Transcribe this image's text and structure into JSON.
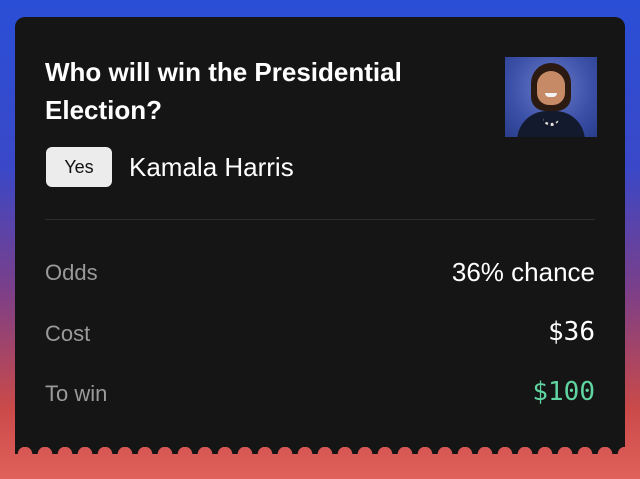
{
  "question": {
    "title": "Who will win the Presidential Election?"
  },
  "selection": {
    "badge": "Yes",
    "candidate": "Kamala Harris"
  },
  "details": {
    "odds_label": "Odds",
    "odds_value": "36% chance",
    "cost_label": "Cost",
    "cost_value": "$36",
    "win_label": "To win",
    "win_value": "$100"
  },
  "colors": {
    "win_accent": "#5fd3a0",
    "card_bg": "#151515"
  }
}
